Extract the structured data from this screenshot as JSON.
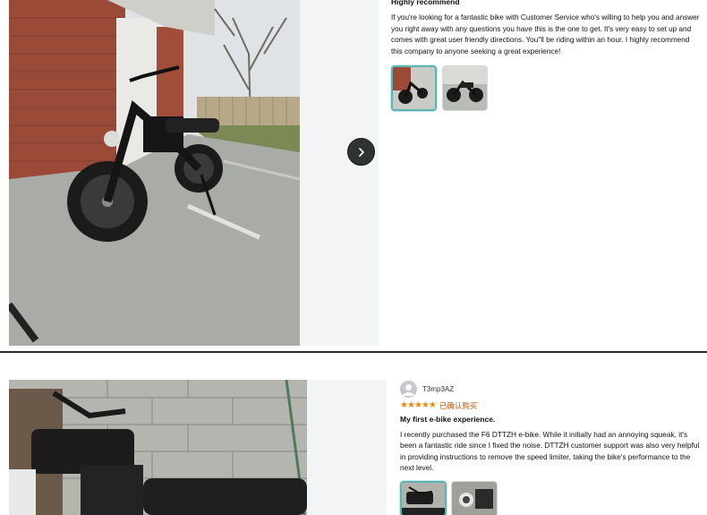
{
  "review_1": {
    "title": "Highly recommend",
    "body": "If you're looking for a fantastic bike with Customer Service who's willing to help you and answer you right away with any questions you have this is the one to get. It's very easy to set up and comes with great user friendly directions. You\"ll be riding within an hour. I highly recommend this company to anyone seeking a great experience!",
    "next_icon": "chevron-right-icon",
    "thumbnails": [
      "thumbnail-1",
      "thumbnail-2"
    ]
  },
  "review_2": {
    "reviewer_name": "T3mp3AZ",
    "stars": "★★★★★",
    "rating": 5,
    "verified_label": "已确认购买",
    "title": "My first e-bike experience.",
    "body": "I recently purchased the F6 DTTZH e-bike. While it initially had an annoying squeak, it's been a fantastic ride since I fixed the noise. DTTZH customer support was also very helpful in providing instructions to remove the speed limiter, taking the bike's performance to the next level.",
    "thumbnails": [
      "thumbnail-1",
      "thumbnail-2"
    ]
  },
  "colors": {
    "star": "#f08804",
    "verified": "#c45500",
    "selected_thumb_border": "#5fb3b3",
    "next_button": "#303333"
  }
}
